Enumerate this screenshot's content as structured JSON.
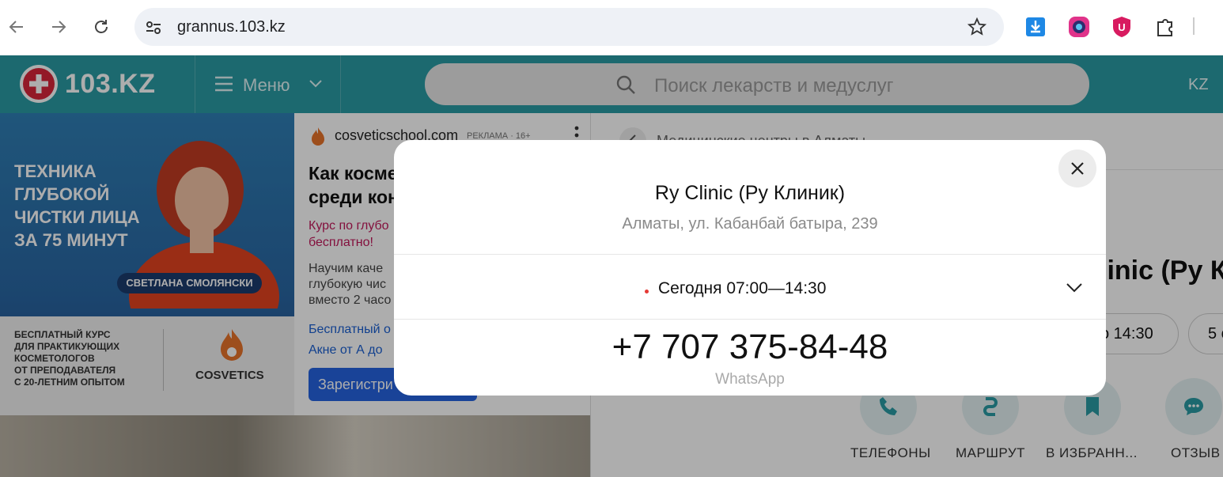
{
  "browser": {
    "url": "grannus.103.kz",
    "colors": {
      "bar": "#ffffff",
      "url_box": "#eef1f6"
    },
    "icons": [
      "back-arrow-icon",
      "forward-arrow-icon",
      "reload-icon",
      "site-info-icon",
      "bookmark-star-icon",
      "download-extension-icon",
      "camera-extension-icon",
      "shield-u-extension-icon",
      "puzzle-extension-icon"
    ]
  },
  "site_header": {
    "logo_text": "103.KZ",
    "menu_label": "Меню",
    "search_placeholder": "Поиск лекарств и медуслуг",
    "lang_switch": "KZ",
    "colors": {
      "header": "#2a9ba4",
      "logo_cross": "#d9263a"
    }
  },
  "ad": {
    "banner_title_lines": [
      "ТЕХНИКА",
      "ГЛУБОКОЙ",
      "ЧИСТКИ ЛИЦА",
      "ЗА 75 МИНУТ"
    ],
    "presenter_name": "СВЕТЛАНА СМОЛЯНСКИ",
    "course_lines": [
      "БЕСПЛАТНЫЙ КУРС",
      "ДЛЯ ПРАКТИКУЮЩИХ",
      "КОСМЕТОЛОГОВ",
      "ОТ ПРЕПОДАВАТЕЛЯ",
      "С 20-ЛЕТНИМ ОПЫТОМ"
    ],
    "brand": "COSVETICS",
    "domain": "cosveticschool.com",
    "label": "РЕКЛАМА · 16+",
    "headline_lines": [
      "Как космет",
      "среди кон"
    ],
    "pink_lines": [
      "Курс по глубо",
      "бесплатно!"
    ],
    "body_lines": [
      "Научим каче",
      "глубокую чис",
      "вместо 2 часо"
    ],
    "link_lines": [
      "Бесплатный о",
      "Акне от А до"
    ],
    "cta": "Зарегистри"
  },
  "page": {
    "breadcrumb": "Медицинские центры в Алматы",
    "title_fragment": "linic (Ру К",
    "pills": [
      "о 14:30",
      "5 о"
    ],
    "actions": [
      {
        "label": "ТЕЛЕФОНЫ",
        "icon": "phone-icon"
      },
      {
        "label": "МАРШРУТ",
        "icon": "route-icon"
      },
      {
        "label": "В ИЗБРАНН...",
        "icon": "bookmark-icon"
      },
      {
        "label": "ОТЗЫВ",
        "icon": "chat-bubble-icon"
      }
    ]
  },
  "modal": {
    "title": "Ry Clinic (Ру Клиник)",
    "address": "Алматы, ул. Кабанбай батыра, 239",
    "hours": "Сегодня 07:00—14:30",
    "phone": "+7 707 375-84-48",
    "phone_type": "WhatsApp",
    "colors": {
      "status_dot": "#e53935"
    }
  }
}
